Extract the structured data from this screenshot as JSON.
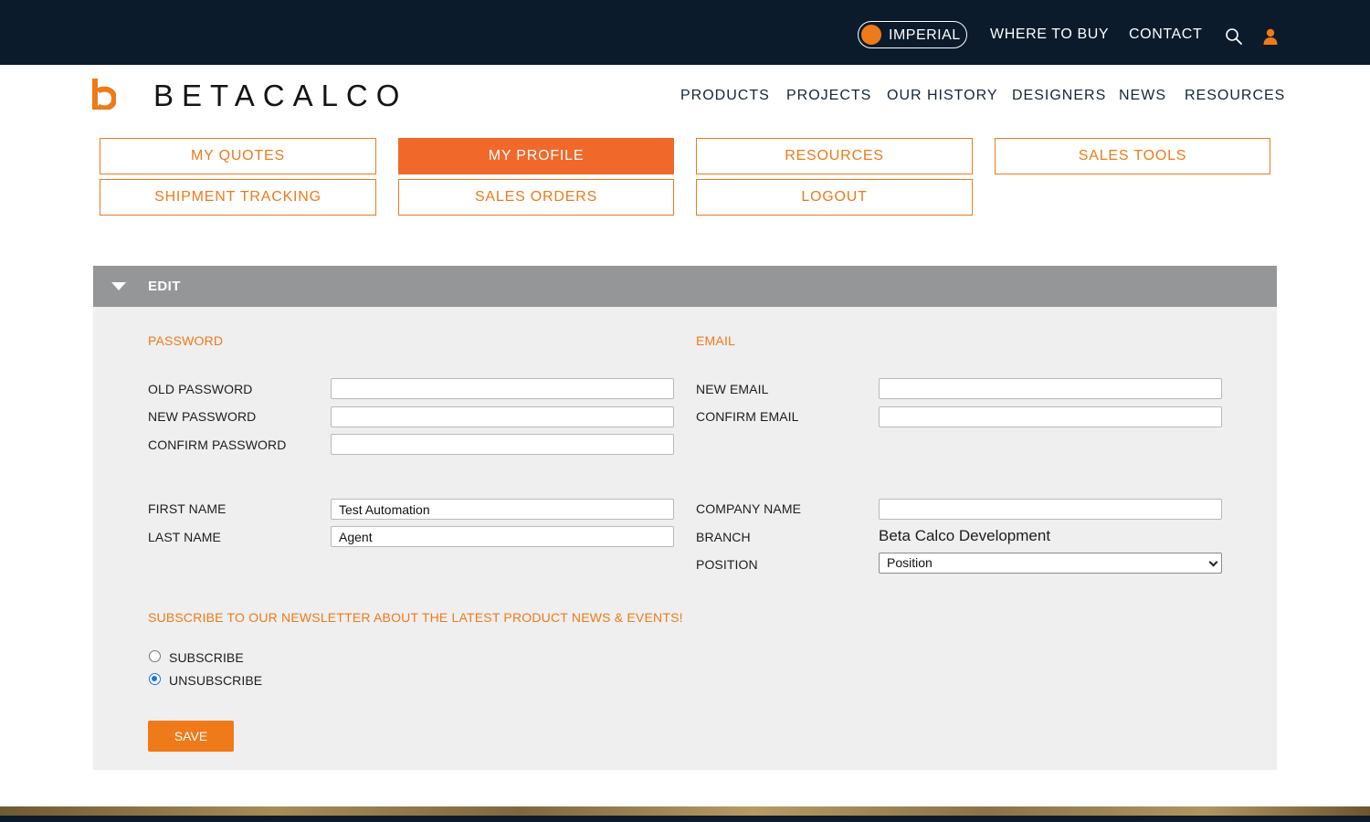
{
  "topbar": {
    "unit_toggle_label": "IMPERIAL",
    "links": [
      "WHERE TO BUY",
      "CONTACT"
    ],
    "icons": [
      "search-icon",
      "user-icon"
    ],
    "background_color": "#0b1b2b",
    "accent_color": "#ef7a1a"
  },
  "header": {
    "logo_text": "BETACALCO",
    "nav": [
      "PRODUCTS",
      "PROJECTS",
      "OUR HISTORY",
      "DESIGNERS",
      "NEWS",
      "RESOURCES"
    ]
  },
  "account_nav": {
    "items": [
      "MY QUOTES",
      "MY PROFILE",
      "RESOURCES",
      "SALES TOOLS",
      "SHIPMENT TRACKING",
      "SALES ORDERS",
      "LOGOUT"
    ],
    "active": "MY PROFILE"
  },
  "edit_panel": {
    "title": "EDIT",
    "password_section": {
      "title": "PASSWORD",
      "old_password_label": "OLD PASSWORD",
      "new_password_label": "NEW PASSWORD",
      "confirm_password_label": "CONFIRM PASSWORD",
      "old_password_value": "",
      "new_password_value": "",
      "confirm_password_value": ""
    },
    "email_section": {
      "title": "EMAIL",
      "new_email_label": "NEW EMAIL",
      "confirm_email_label": "CONFIRM EMAIL",
      "new_email_value": "",
      "confirm_email_value": ""
    },
    "profile": {
      "first_name_label": "FIRST NAME",
      "first_name_value": "Test Automation",
      "last_name_label": "LAST NAME",
      "last_name_value": "Agent",
      "company_name_label": "COMPANY NAME",
      "company_name_value": "",
      "branch_label": "BRANCH",
      "branch_value": "Beta Calco Development",
      "position_label": "POSITION",
      "position_selected": "Position"
    },
    "newsletter": {
      "title": "SUBSCRIBE TO OUR NEWSLETTER ABOUT THE LATEST PRODUCT NEWS & EVENTS!",
      "options": [
        "SUBSCRIBE",
        "UNSUBSCRIBE"
      ],
      "selected": "UNSUBSCRIBE"
    },
    "save_label": "SAVE"
  }
}
